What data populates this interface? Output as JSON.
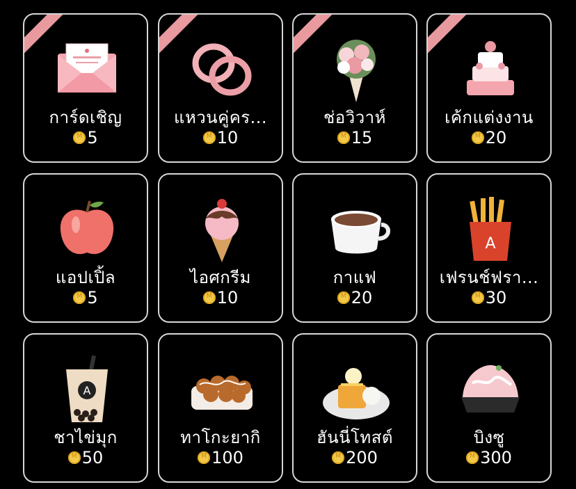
{
  "gifts": [
    {
      "name": "การ์ดเชิญ",
      "price": "5",
      "icon": "invitation-card-icon",
      "ribbon": true
    },
    {
      "name": "แหวนคู่คร...",
      "price": "10",
      "icon": "couple-rings-icon",
      "ribbon": true
    },
    {
      "name": "ช่อวิวาห์",
      "price": "15",
      "icon": "wedding-bouquet-icon",
      "ribbon": true
    },
    {
      "name": "เค้กแต่งงาน",
      "price": "20",
      "icon": "wedding-cake-icon",
      "ribbon": true
    },
    {
      "name": "แอปเปิ้ล",
      "price": "5",
      "icon": "apple-icon",
      "ribbon": false
    },
    {
      "name": "ไอศกรีม",
      "price": "10",
      "icon": "ice-cream-icon",
      "ribbon": false
    },
    {
      "name": "กาแฟ",
      "price": "20",
      "icon": "coffee-icon",
      "ribbon": false
    },
    {
      "name": "เฟรนช์ฟรา...",
      "price": "30",
      "icon": "french-fries-icon",
      "ribbon": false
    },
    {
      "name": "ชาไข่มุก",
      "price": "50",
      "icon": "bubble-tea-icon",
      "ribbon": false
    },
    {
      "name": "ทาโกะยากิ",
      "price": "100",
      "icon": "takoyaki-icon",
      "ribbon": false
    },
    {
      "name": "ฮันนี่โทสต์",
      "price": "200",
      "icon": "honey-toast-icon",
      "ribbon": false
    },
    {
      "name": "บิงซู",
      "price": "300",
      "icon": "bingsu-icon",
      "ribbon": false
    }
  ],
  "colors": {
    "ribbon": "#e99a9f",
    "border": "#d7d7d7",
    "coin": "#f3c94a"
  }
}
